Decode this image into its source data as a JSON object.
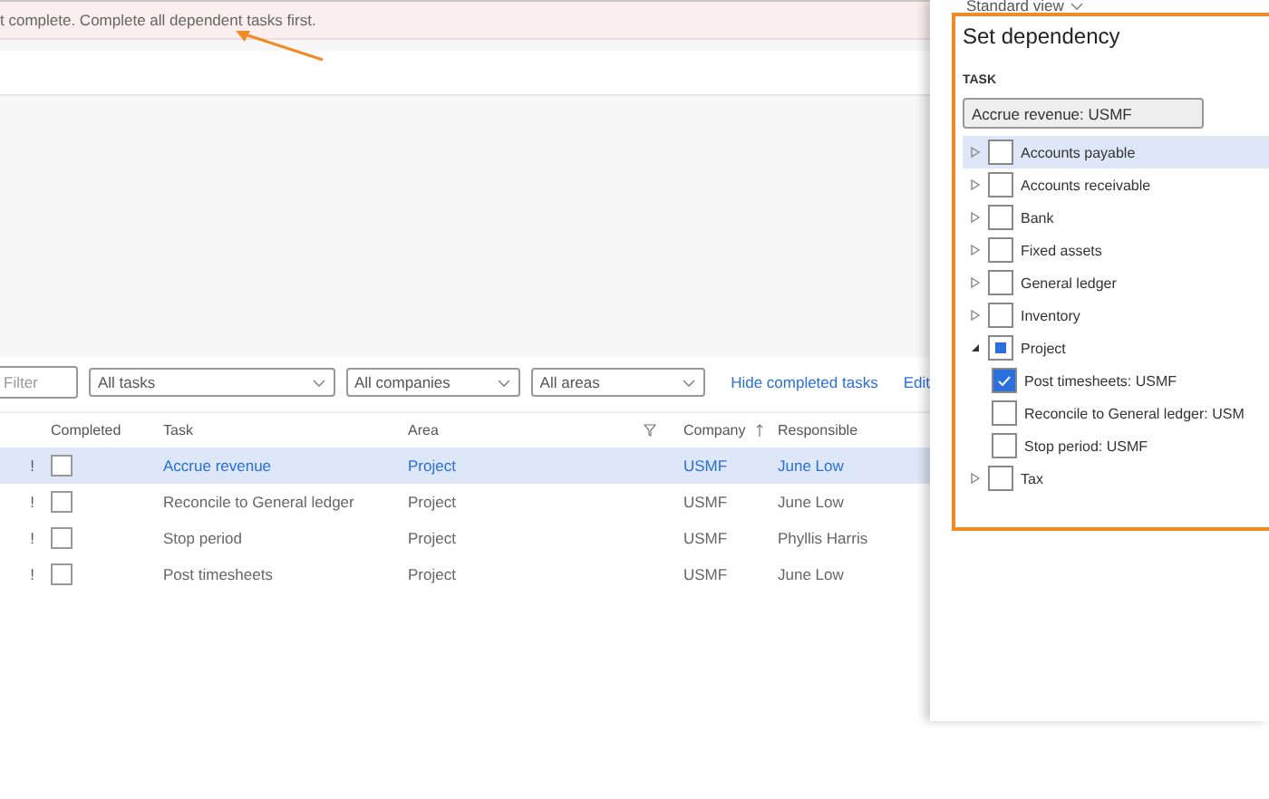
{
  "banner": {
    "message": "t complete. Complete all dependent tasks first."
  },
  "filters": {
    "filter": {
      "placeholder": "Filter"
    },
    "dropdowns": [
      "All tasks",
      "All companies",
      "All areas"
    ],
    "links": [
      "Hide completed tasks",
      "Edit"
    ]
  },
  "table": {
    "columns": [
      "Completed",
      "Task",
      "Area",
      "Company",
      "Responsible"
    ],
    "rows": [
      {
        "flag": "!",
        "completed": false,
        "selected": true,
        "task": "Accrue revenue",
        "area": "Project",
        "company": "USMF",
        "responsible": "June Low"
      },
      {
        "flag": "!",
        "completed": false,
        "selected": false,
        "task": "Reconcile to General ledger",
        "area": "Project",
        "company": "USMF",
        "responsible": "June Low"
      },
      {
        "flag": "!",
        "completed": false,
        "selected": false,
        "task": "Stop period",
        "area": "Project",
        "company": "USMF",
        "responsible": "Phyllis Harris"
      },
      {
        "flag": "!",
        "completed": false,
        "selected": false,
        "task": "Post timesheets",
        "area": "Project",
        "company": "USMF",
        "responsible": "June Low"
      }
    ]
  },
  "view": {
    "label": "Standard view"
  },
  "panel": {
    "title": "Set dependency",
    "task_label": "TASK",
    "task_value": "Accrue revenue: USMF",
    "tree": [
      {
        "label": "Accounts payable",
        "expanded": false,
        "checked": false,
        "partial": false,
        "selected": true
      },
      {
        "label": "Accounts receivable",
        "expanded": false,
        "checked": false,
        "partial": false,
        "selected": false
      },
      {
        "label": "Bank",
        "expanded": false,
        "checked": false,
        "partial": false,
        "selected": false
      },
      {
        "label": "Fixed assets",
        "expanded": false,
        "checked": false,
        "partial": false,
        "selected": false
      },
      {
        "label": "General ledger",
        "expanded": false,
        "checked": false,
        "partial": false,
        "selected": false
      },
      {
        "label": "Inventory",
        "expanded": false,
        "checked": false,
        "partial": false,
        "selected": false
      },
      {
        "label": "Project",
        "expanded": true,
        "checked": false,
        "partial": true,
        "selected": false,
        "children": [
          {
            "label": "Post timesheets: USMF",
            "checked": true,
            "partial": false,
            "selected": false
          },
          {
            "label": "Reconcile to General ledger: USM",
            "checked": false,
            "partial": false,
            "selected": false
          },
          {
            "label": "Stop period: USMF",
            "checked": false,
            "partial": false,
            "selected": false
          }
        ]
      },
      {
        "label": "Tax",
        "expanded": false,
        "checked": false,
        "partial": false,
        "selected": false
      }
    ]
  }
}
